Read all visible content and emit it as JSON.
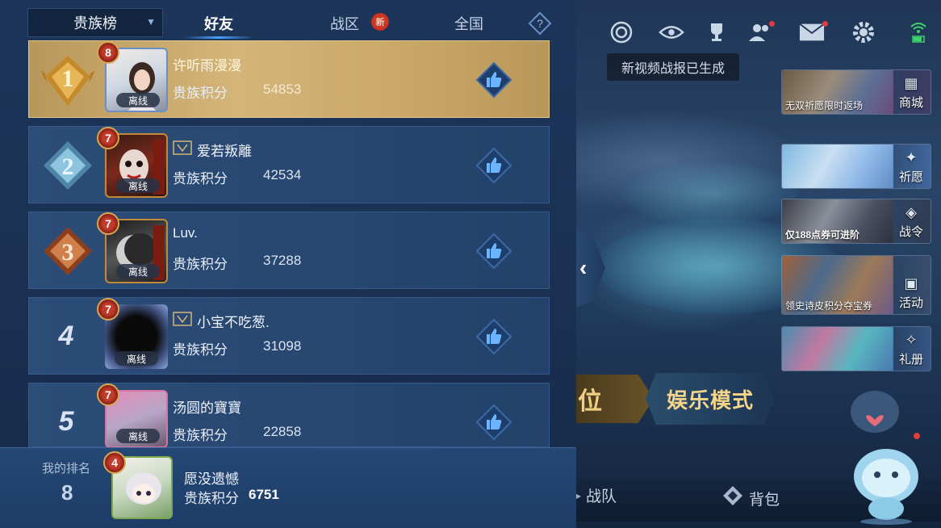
{
  "tabs": {
    "dropdown_label": "贵族榜",
    "friends": "好友",
    "region": "战区",
    "region_badge": "新",
    "national": "全国",
    "help": "?"
  },
  "ranking": [
    {
      "rank": "1",
      "level": "8",
      "name": "许听雨漫漫",
      "score_label": "贵族积分",
      "score": "54853",
      "status": "离线",
      "rank_color": "#d8a945"
    },
    {
      "rank": "2",
      "level": "7",
      "name": "爱若叛離",
      "score_label": "贵族积分",
      "score": "42534",
      "status": "离线",
      "rank_color": "#7fb6d9"
    },
    {
      "rank": "3",
      "level": "7",
      "name": "Luv.",
      "score_label": "贵族积分",
      "score": "37288",
      "status": "离线",
      "rank_color": "#c46f3c"
    },
    {
      "rank": "4",
      "level": "7",
      "name": "小宝不吃葱.",
      "score_label": "贵族积分",
      "score": "31098",
      "status": "离线"
    },
    {
      "rank": "5",
      "level": "7",
      "name": "汤圆的寶寶",
      "score_label": "贵族积分",
      "score": "22858",
      "status": "离线"
    }
  ],
  "my_rank": {
    "label": "我的排名",
    "rank": "8",
    "level": "4",
    "name": "愿没遗憾",
    "score_label": "贵族积分",
    "score": "6751"
  },
  "lobby": {
    "toast": "新视频战报已生成",
    "side_cards": [
      {
        "caption": "无双祈愿限时返场",
        "button": "商城",
        "icon": "store-icon"
      },
      {
        "caption": "",
        "button": "祈愿",
        "icon": "wish-icon"
      },
      {
        "caption": "仅188点券可进阶",
        "button": "战令",
        "icon": "battle-pass-icon"
      },
      {
        "caption": "领史诗皮积分夺宝券",
        "button": "活动",
        "icon": "event-icon"
      },
      {
        "caption": "",
        "button": "礼册",
        "icon": "gift-book-icon"
      }
    ],
    "mode_left": "位",
    "mode_right": "娱乐模式",
    "bottom_team": "战队",
    "bottom_bag": "背包"
  },
  "colors": {
    "accent": "#4ca0ff",
    "gold": "#d4b57a",
    "panel": "#1c3559"
  }
}
